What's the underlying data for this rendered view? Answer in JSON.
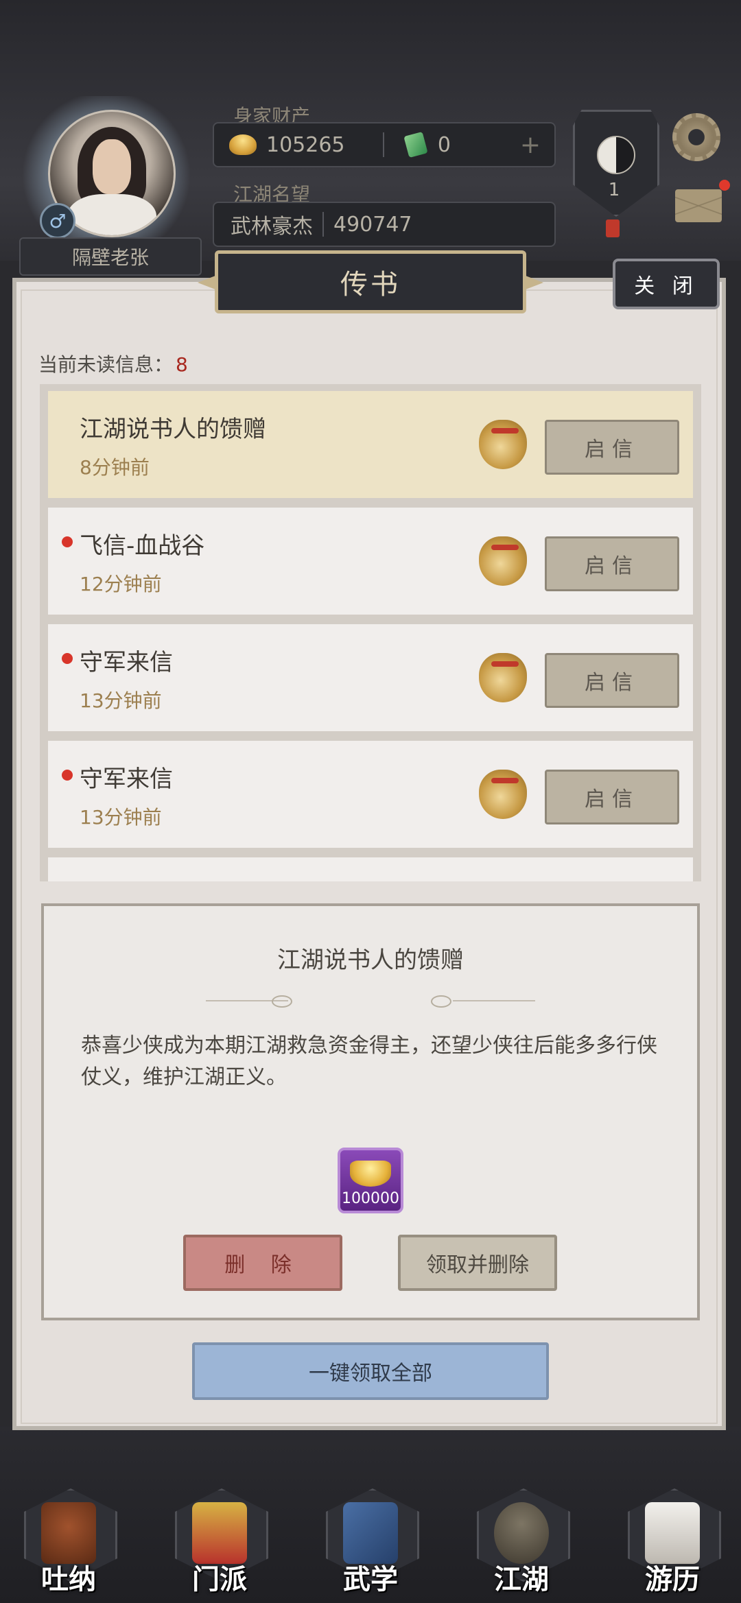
{
  "header": {
    "player_name": "隔壁老张",
    "wealth_label": "身家财产",
    "gold": "105265",
    "jade": "0",
    "reputation_label": "江湖名望",
    "rank": "武林豪杰",
    "reputation_value": "490747",
    "taiji_level": "1"
  },
  "panel": {
    "title": "传书",
    "close_label": "关 闭",
    "unread_label": "当前未读信息：",
    "unread_count": "8"
  },
  "messages": [
    {
      "title": "江湖说书人的馈赠",
      "time": "8分钟前",
      "button": "启信",
      "unread": false,
      "active": true
    },
    {
      "title": "飞信-血战谷",
      "time": "12分钟前",
      "button": "启信",
      "unread": true,
      "active": false
    },
    {
      "title": "守军来信",
      "time": "13分钟前",
      "button": "启信",
      "unread": true,
      "active": false
    },
    {
      "title": "守军来信",
      "time": "13分钟前",
      "button": "启信",
      "unread": true,
      "active": false
    }
  ],
  "detail": {
    "title": "江湖说书人的馈赠",
    "body": "恭喜少侠成为本期江湖救急资金得主，还望少侠往后能多多行侠仗义，维护江湖正义。",
    "reward_count": "100000",
    "reward_icon": "gold-ingot-icon",
    "delete_label": "删 除",
    "claim_delete_label": "领取并删除",
    "claim_all_label": "一键领取全部"
  },
  "nav": [
    {
      "label": "吐纳",
      "icon": "meditation-icon"
    },
    {
      "label": "门派",
      "icon": "sect-banner-icon"
    },
    {
      "label": "武学",
      "icon": "martial-books-icon"
    },
    {
      "label": "江湖",
      "icon": "bamboo-hat-icon"
    },
    {
      "label": "游历",
      "icon": "white-horse-icon"
    }
  ],
  "colors": {
    "accent_red": "#a8281f",
    "panel_bg": "#e4dfdb",
    "claim_all_blue": "#9cb5d6"
  }
}
